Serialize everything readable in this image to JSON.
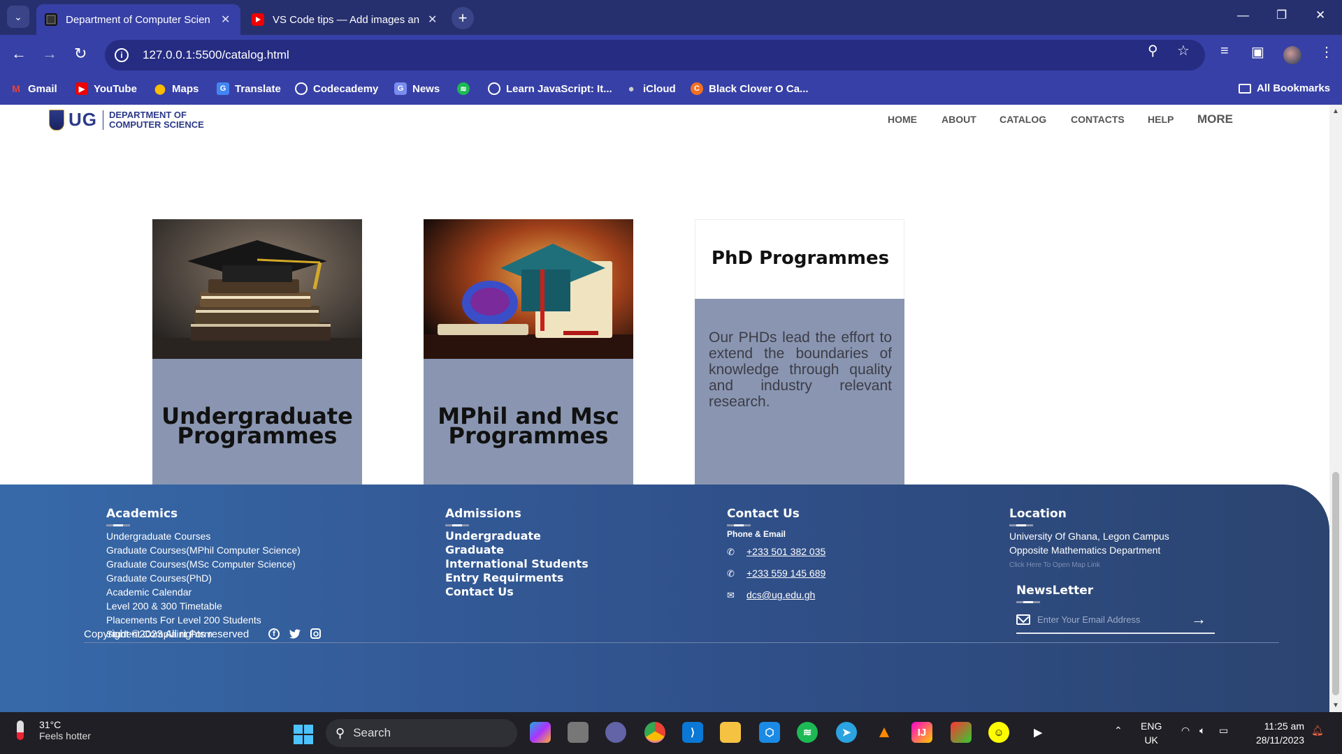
{
  "browser": {
    "tabs": [
      {
        "title": "Department of Computer Scien",
        "active": true
      },
      {
        "title": "VS Code tips — Add images an",
        "active": false
      }
    ],
    "url": "127.0.0.1:5500/catalog.html",
    "bookmarks": [
      "Gmail",
      "YouTube",
      "Maps",
      "Translate",
      "Codecademy",
      "News",
      "",
      "Learn JavaScript: It...",
      "iCloud",
      "Black Clover O Ca..."
    ],
    "all_bookmarks": "All Bookmarks"
  },
  "site": {
    "logo": {
      "abbr": "UG",
      "line1": "DEPARTMENT OF",
      "line2": "COMPUTER SCIENCE"
    },
    "nav": [
      "HOME",
      "ABOUT",
      "CATALOG",
      "CONTACTS",
      "HELP",
      "MORE"
    ]
  },
  "cards": {
    "undergraduate": {
      "line1": "Undergraduate",
      "line2": "Programmes"
    },
    "mphil": {
      "line1": "MPhil and Msc",
      "line2": "Programmes"
    },
    "phd": {
      "title": "PhD Programmes",
      "description": "Our PHDs lead the effort to extend the boundaries of knowledge through quality and industry relevant research."
    }
  },
  "footer": {
    "academics": {
      "heading": "Academics",
      "links": [
        "Undergraduate Courses",
        "Graduate Courses(MPhil Computer Science)",
        "Graduate Courses(MSc Computer Science)",
        "Graduate Courses(PhD)",
        "Academic Calendar",
        "Level 200 & 300 Timetable",
        "Placements For Level 200 Students",
        "Student Complaint Form"
      ]
    },
    "admissions": {
      "heading": "Admissions",
      "links": [
        "Undergraduate",
        "Graduate",
        "International Students",
        "Entry Requirments",
        "Contact Us"
      ]
    },
    "contact": {
      "heading": "Contact Us",
      "subheading": "Phone & Email",
      "phone1": "+233 501 382 035",
      "phone2": "+233 559 145 689",
      "email": "dcs@ug.edu.gh"
    },
    "location": {
      "heading": "Location",
      "line1": "University Of Ghana, Legon Campus",
      "line2": "Opposite Mathematics Department",
      "map_link": "Click Here To Open Map Link"
    },
    "newsletter": {
      "heading": "NewsLetter",
      "placeholder": "Enter Your Email Address"
    },
    "copyright": "Copyright ©2023 All rights reserved"
  },
  "taskbar": {
    "weather_temp": "31°C",
    "weather_desc": "Feels hotter",
    "search": "Search",
    "lang1": "ENG",
    "lang2": "UK",
    "time": "11:25 am",
    "date": "28/11/2023"
  },
  "colors": {
    "footer_start": "#3769a9",
    "footer_end": "#2b4470",
    "card_body": "#8a96b1",
    "chrome": "#3740a6"
  }
}
